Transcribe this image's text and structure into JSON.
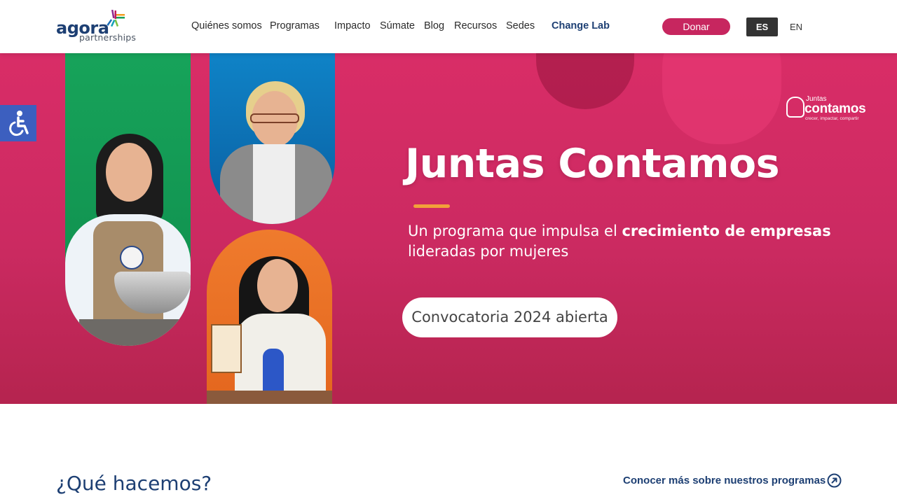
{
  "brand": {
    "logo_word": "agora",
    "logo_sub": "partnerships"
  },
  "nav": {
    "items": [
      "Quiénes somos",
      "Programas",
      "Impacto",
      "Súmate",
      "Blog",
      "Recursos",
      "Sedes"
    ],
    "highlight": "Change Lab",
    "donate_label": "Donar",
    "lang_active": "ES",
    "lang_other": "EN"
  },
  "hero": {
    "title": "Juntas Contamos",
    "subtitle_plain": "Un programa que impulsa el ",
    "subtitle_bold": "crecimiento de empresas",
    "subtitle_end": "lideradas por mujeres",
    "cta": "Convocatoria 2024 abierta",
    "badge_top": "Juntas",
    "badge_main": "contamos",
    "badge_small": "crecer, impactar, compartir"
  },
  "section": {
    "title": "¿Qué hacemos?",
    "more_link": "Conocer más sobre nuestros programas"
  },
  "colors": {
    "brand_navy": "#1d3f73",
    "donate": "#c7265f",
    "hero_pink": "#d92d67",
    "a11y_blue": "#3c5fbf"
  },
  "icons": {
    "accessibility": "accessibility-icon",
    "arrow_circle": "arrow-up-right-circle-icon"
  }
}
